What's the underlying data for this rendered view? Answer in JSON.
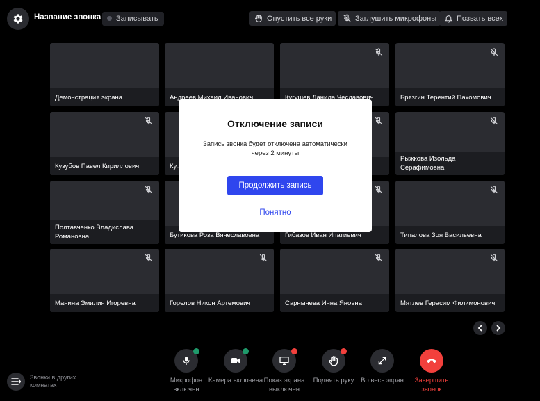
{
  "header": {
    "title": "Название звонка",
    "record_label": "Записывать",
    "lower_hands_label": "Опустить все руки",
    "mute_mics_label": "Заглушить микрофоны",
    "call_all_label": "Позвать всех"
  },
  "participants": [
    {
      "name": "Демонстрация экрана",
      "muted": false
    },
    {
      "name": "Андреев Михаил Иванович",
      "muted": false
    },
    {
      "name": "Кугушев Данила Чеславович",
      "muted": true
    },
    {
      "name": "Брязгин Терентий Пахомович",
      "muted": true
    },
    {
      "name": "Кузубов Павел Кириллович",
      "muted": true
    },
    {
      "name": "Ку... Не...",
      "muted": true
    },
    {
      "name": "",
      "muted": true
    },
    {
      "name": "Рыжкова Изольда Серафимовна",
      "muted": true
    },
    {
      "name": "Полтавченко Владислава Романовна",
      "muted": true
    },
    {
      "name": "Бутикова Роза Вячеславовна",
      "muted": true
    },
    {
      "name": "Гибазов Иван Ипатиевич",
      "muted": true
    },
    {
      "name": "Типалова Зоя Васильевна",
      "muted": true
    },
    {
      "name": "Манина Эмилия Игоревна",
      "muted": true
    },
    {
      "name": "Горелов Никон Артемович",
      "muted": true
    },
    {
      "name": "Сарнычева Инна Яновна",
      "muted": true
    },
    {
      "name": "Мятлев Герасим Филимонович",
      "muted": true
    }
  ],
  "modal": {
    "title": "Отключение записи",
    "text": "Запись звонка будет отключена автоматически через 2 минуты",
    "primary_label": "Продолжить запись",
    "secondary_label": "Понятно"
  },
  "controls": {
    "mic_label": "Микрофон включен",
    "camera_label": "Камера включена",
    "screen_label": "Показ экрана выключен",
    "hand_label": "Поднять руку",
    "fullscreen_label": "Во весь экран",
    "end_label": "Завершить звонок"
  },
  "rooms": {
    "label": "Звонки в других комнатах"
  },
  "colors": {
    "background": "#000000",
    "tile": "#2b2c31",
    "accent": "#2f46ee",
    "status_on": "#1f9a6b",
    "status_off": "#f2403c",
    "end_call": "#f2403c"
  }
}
